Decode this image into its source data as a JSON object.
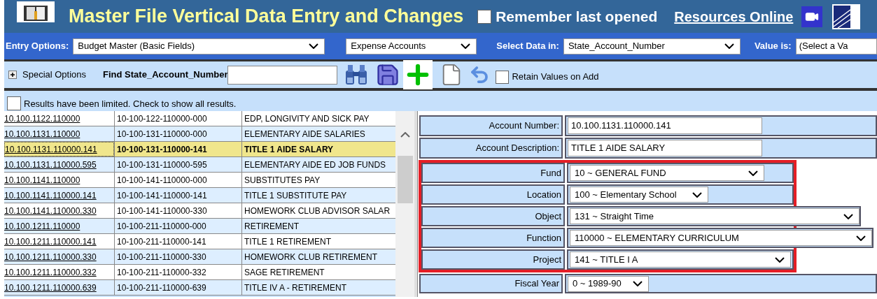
{
  "header": {
    "title": "Master File Vertical Data Entry and Changes",
    "remember": {
      "label": "Remember last opened",
      "checked": false
    },
    "link": "Resources Online"
  },
  "options_bar": {
    "entry_label": "Entry Options:",
    "entry_value": "Budget Master (Basic Fields)",
    "type_value": "Expense Accounts",
    "select_label": "Select Data in:",
    "select_value": "State_Account_Number",
    "value_label": "Value is:",
    "value_value": "(Select a Va"
  },
  "toolbar": {
    "special_options": "Special Options",
    "special_expanded": false,
    "find_label": "Find State_Account_Number",
    "retain": {
      "label": "Retain Values on Add",
      "checked": false
    }
  },
  "limit": {
    "label": "Results have been limited. Check to show all results.",
    "checked": false
  },
  "table": {
    "rows": [
      {
        "account": "10.100.1122.110000",
        "state": "10-100-122-110000-000",
        "description": "EDP, LONGIVITY AND SICK PAY",
        "selected": false
      },
      {
        "account": "10.100.1131.110000",
        "state": "10-100-131-110000-000",
        "description": "ELEMENTARY AIDE SALARIES",
        "selected": false
      },
      {
        "account": "10.100.1131.110000.141",
        "state": "10-100-131-110000-141",
        "description": "TITLE 1 AIDE SALARY",
        "selected": true
      },
      {
        "account": "10.100.1131.110000.595",
        "state": "10-100-131-110000-595",
        "description": "ELEMENTARY AIDE ED JOB FUNDS",
        "selected": false
      },
      {
        "account": "10.100.1141.110000",
        "state": "10-100-141-110000-000",
        "description": "SUBSTITUTES PAY",
        "selected": false
      },
      {
        "account": "10.100.1141.110000.141",
        "state": "10-100-141-110000-141",
        "description": "TITLE 1 SUBSTITUTE PAY",
        "selected": false
      },
      {
        "account": "10.100.1141.110000.330",
        "state": "10-100-141-110000-330",
        "description": "HOMEWORK CLUB ADVISOR SALAR",
        "selected": false
      },
      {
        "account": "10.100.1211.110000",
        "state": "10-100-211-110000-000",
        "description": "RETIREMENT",
        "selected": false
      },
      {
        "account": "10.100.1211.110000.141",
        "state": "10-100-211-110000-141",
        "description": "TITLE 1 RETIREMENT",
        "selected": false
      },
      {
        "account": "10.100.1211.110000.330",
        "state": "10-100-211-110000-330",
        "description": "HOMEWORK CLUB RETIREMENT",
        "selected": false
      },
      {
        "account": "10.100.1211.110000.332",
        "state": "10-100-211-110000-332",
        "description": "SAGE RETIREMENT",
        "selected": false
      },
      {
        "account": "10.100.1211.110000.639",
        "state": "10-100-211-110000-639",
        "description": "TITLE IV A - RETIREMENT",
        "selected": false
      }
    ]
  },
  "form": {
    "fields": [
      {
        "label": "Account Number:",
        "kind": "input",
        "value": "10.100.1131.110000.141"
      },
      {
        "label": "Account Description:",
        "kind": "input",
        "value": "TITLE 1 AIDE SALARY"
      }
    ],
    "highlighted_fields": [
      {
        "label": "Fund",
        "kind": "select",
        "value": "10 ~ GENERAL FUND"
      },
      {
        "label": "Location",
        "kind": "select",
        "value": "100 ~ Elementary School"
      },
      {
        "label": "Object",
        "kind": "select",
        "value": "131 ~ Straight Time"
      },
      {
        "label": "Function",
        "kind": "select",
        "value": "110000 ~ ELEMENTARY CURRICULUM"
      },
      {
        "label": "Project",
        "kind": "select",
        "value": "141 ~ TITLE I A"
      }
    ],
    "more_fields": [
      {
        "label": "Fiscal Year",
        "kind": "select",
        "value": "0 ~ 1989-90"
      }
    ]
  }
}
